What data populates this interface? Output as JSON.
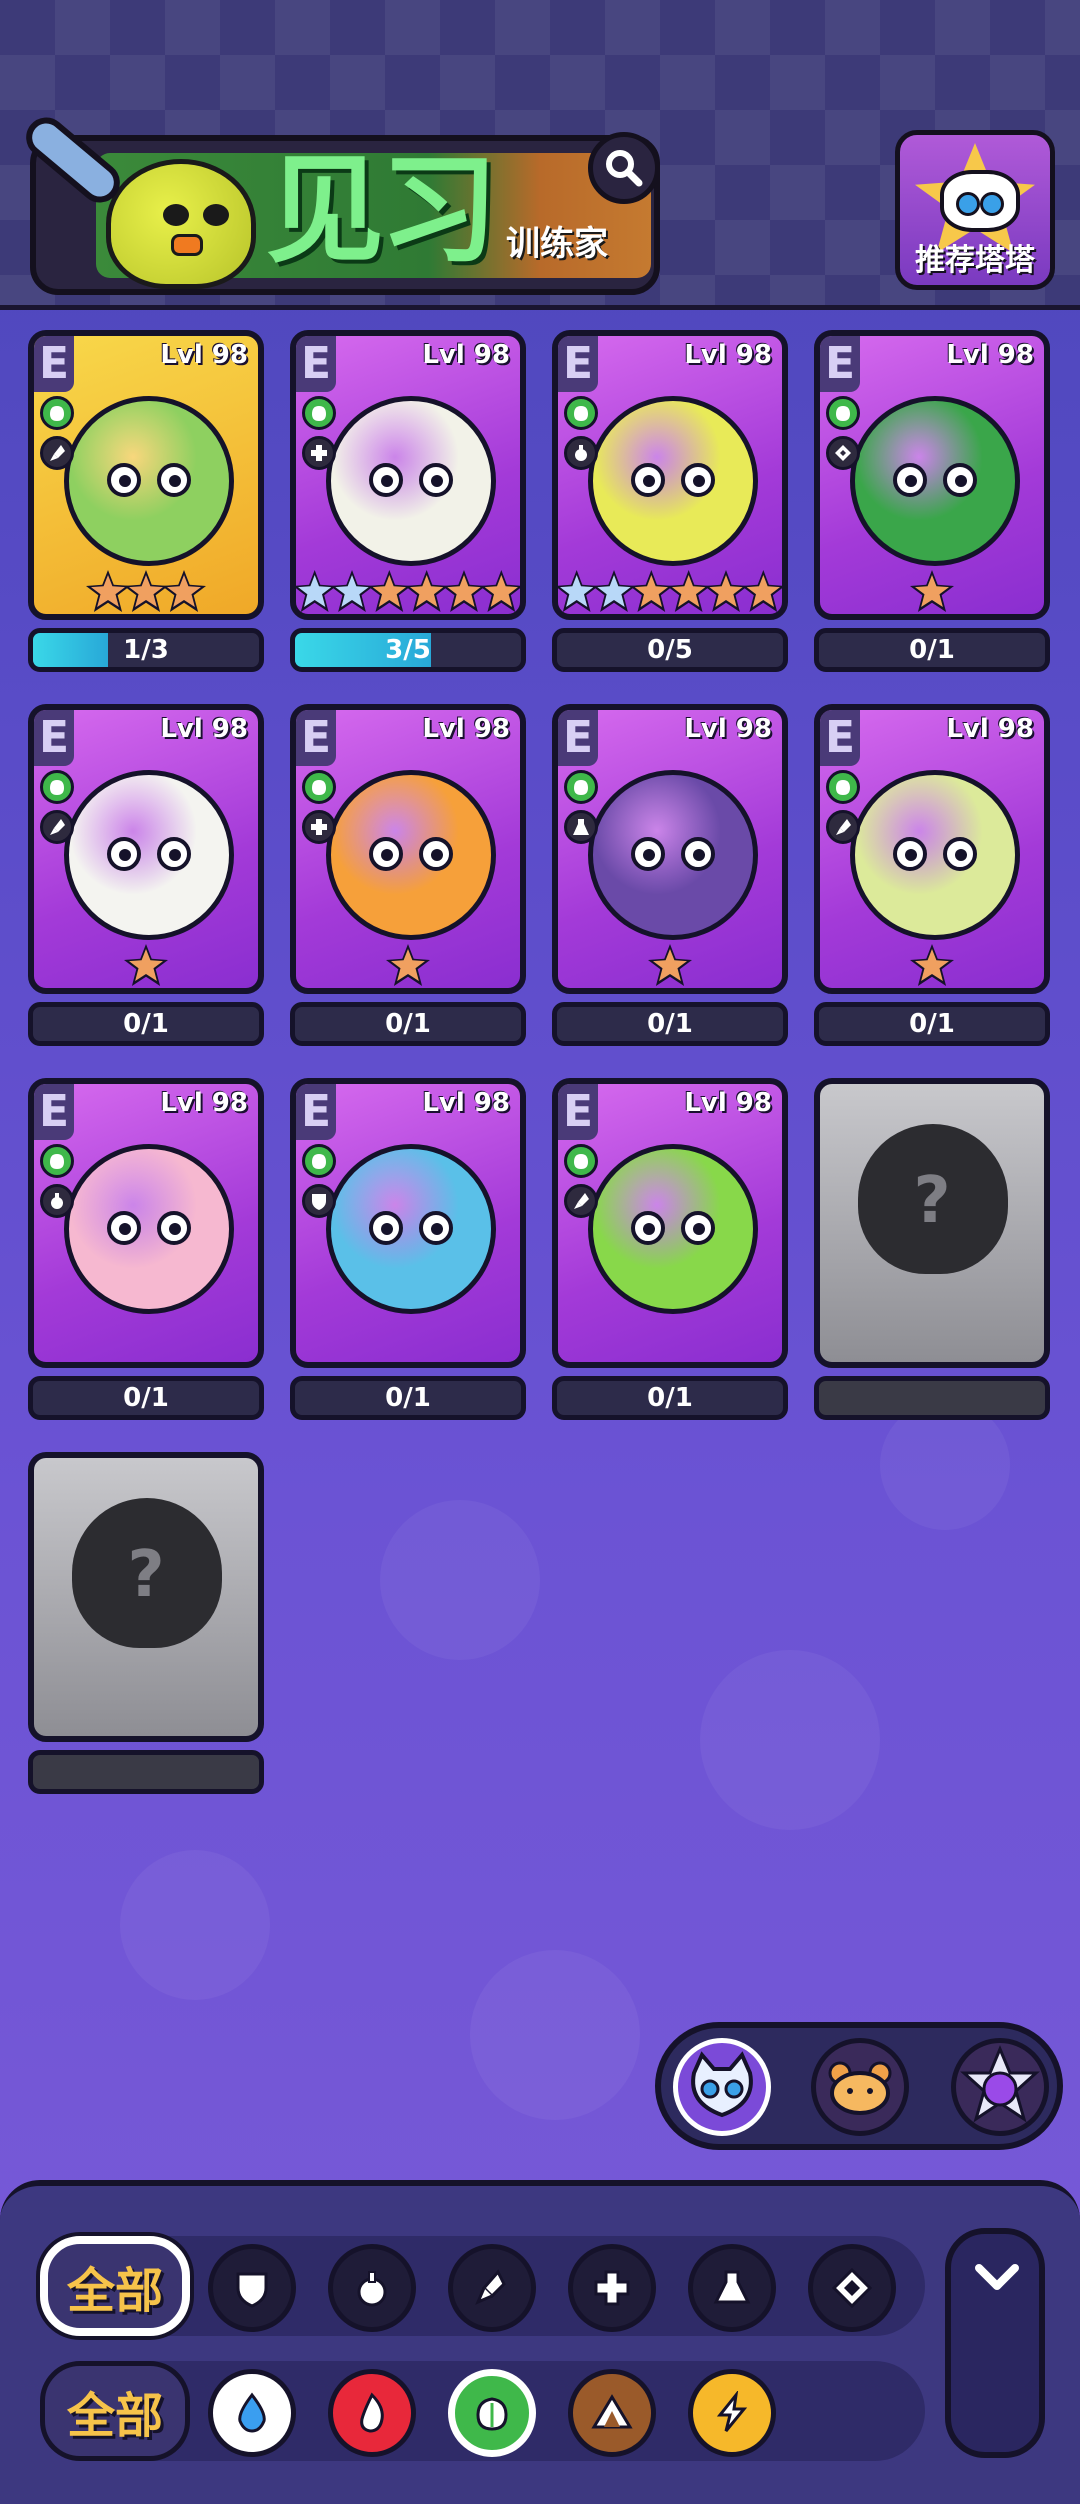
{
  "header": {
    "title": "见习",
    "subtitle": "训练家",
    "tower_button_label": "推荐塔塔"
  },
  "cards": [
    {
      "rank": "E",
      "level": "Lvl 98",
      "element": "grass",
      "class": "rocket",
      "bg": "gold",
      "stars": [
        "bronze",
        "bronze",
        "bronze"
      ],
      "progress": "1/3",
      "progress_fraction": 0.333,
      "pet_color": "#8ed060"
    },
    {
      "rank": "E",
      "level": "Lvl 98",
      "element": "grass",
      "class": "heal",
      "bg": "purple",
      "stars": [
        "blue",
        "blue",
        "bronze",
        "bronze",
        "bronze",
        "bronze"
      ],
      "progress": "3/5",
      "progress_fraction": 0.6,
      "pet_color": "#f2f2e8"
    },
    {
      "rank": "E",
      "level": "Lvl 98",
      "element": "grass",
      "class": "bomb",
      "bg": "purple",
      "stars": [
        "blue",
        "blue",
        "bronze",
        "bronze",
        "bronze",
        "bronze"
      ],
      "progress": "0/5",
      "progress_fraction": 0,
      "pet_color": "#e8ea58"
    },
    {
      "rank": "E",
      "level": "Lvl 98",
      "element": "grass",
      "class": "diamond",
      "bg": "purple",
      "stars": [
        "bronze"
      ],
      "progress": "0/1",
      "progress_fraction": 0,
      "pet_color": "#3aa64a"
    },
    {
      "rank": "E",
      "level": "Lvl 98",
      "element": "grass",
      "class": "rocket",
      "bg": "purple",
      "stars": [
        "bronze"
      ],
      "progress": "0/1",
      "progress_fraction": 0,
      "pet_color": "#f4f4f0"
    },
    {
      "rank": "E",
      "level": "Lvl 98",
      "element": "grass",
      "class": "heal",
      "bg": "purple",
      "stars": [
        "bronze"
      ],
      "progress": "0/1",
      "progress_fraction": 0,
      "pet_color": "#f6a03a"
    },
    {
      "rank": "E",
      "level": "Lvl 98",
      "element": "grass",
      "class": "flask",
      "bg": "purple",
      "stars": [
        "bronze"
      ],
      "progress": "0/1",
      "progress_fraction": 0,
      "pet_color": "#6a4aa8"
    },
    {
      "rank": "E",
      "level": "Lvl 98",
      "element": "grass",
      "class": "rocket",
      "bg": "purple",
      "stars": [
        "bronze"
      ],
      "progress": "0/1",
      "progress_fraction": 0,
      "pet_color": "#dcea9a"
    },
    {
      "rank": "E",
      "level": "Lvl 98",
      "element": "grass",
      "class": "bomb",
      "bg": "purple",
      "stars": [],
      "progress": "0/1",
      "progress_fraction": 0,
      "pet_color": "#f6b8d0"
    },
    {
      "rank": "E",
      "level": "Lvl 98",
      "element": "grass",
      "class": "shield",
      "bg": "purple",
      "stars": [],
      "progress": "0/1",
      "progress_fraction": 0,
      "pet_color": "#5ac0e8"
    },
    {
      "rank": "E",
      "level": "Lvl 98",
      "element": "grass",
      "class": "rocket",
      "bg": "purple",
      "stars": [],
      "progress": "0/1",
      "progress_fraction": 0,
      "pet_color": "#88d84a"
    },
    {
      "locked": true,
      "bg": "grey",
      "progress": "",
      "question": "?"
    },
    {
      "locked": true,
      "bg": "grey",
      "progress": "",
      "question": "?"
    }
  ],
  "owner_tabs": [
    "cat-icon",
    "bear-icon",
    "star-cat-icon"
  ],
  "filters": {
    "class_row": {
      "all_label": "全部",
      "selected": "all",
      "icons": [
        "shield-icon",
        "bomb-icon",
        "rocket-icon",
        "heal-icon",
        "flask-icon",
        "diamond-icon"
      ]
    },
    "element_row": {
      "all_label": "全部",
      "selected": "grass",
      "icons": [
        "water-icon",
        "fire-icon",
        "grass-icon",
        "earth-icon",
        "lightning-icon"
      ]
    }
  },
  "colors": {
    "water": "#3a9ef0",
    "fire": "#e8283a",
    "grass": "#3fb84a",
    "earth": "#9a5a2a",
    "lightning": "#f6b82a",
    "accent_text": "#f6c34a"
  }
}
